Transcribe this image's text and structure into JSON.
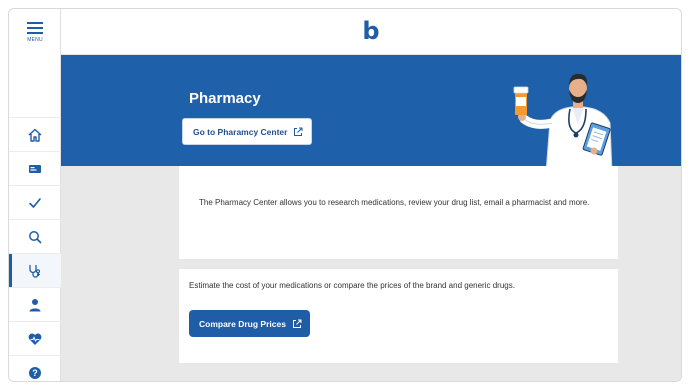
{
  "sidebar": {
    "menu_label": "MENU",
    "items": [
      {
        "icon": "home-icon",
        "active": false
      },
      {
        "icon": "id-card-icon",
        "active": false
      },
      {
        "icon": "checkmark-icon",
        "active": false
      },
      {
        "icon": "search-icon",
        "active": false
      },
      {
        "icon": "stethoscope-icon",
        "active": true
      },
      {
        "icon": "person-icon",
        "active": false
      },
      {
        "icon": "heart-pulse-icon",
        "active": false
      },
      {
        "icon": "help-icon",
        "active": false
      }
    ]
  },
  "header": {
    "logo_text": "b"
  },
  "banner": {
    "title": "Pharmacy",
    "button_label": "Go to Pharamcy Center"
  },
  "card1": {
    "text": "The Pharmacy Center allows you to research medications, review your drug list, email a pharmacist and more."
  },
  "card2": {
    "text": "Estimate the cost of your medications or compare the prices of the brand and generic drugs.",
    "button_label": "Compare Drug Prices"
  },
  "colors": {
    "brand_blue": "#1f60ab",
    "background_gray": "#e8e8e8"
  }
}
